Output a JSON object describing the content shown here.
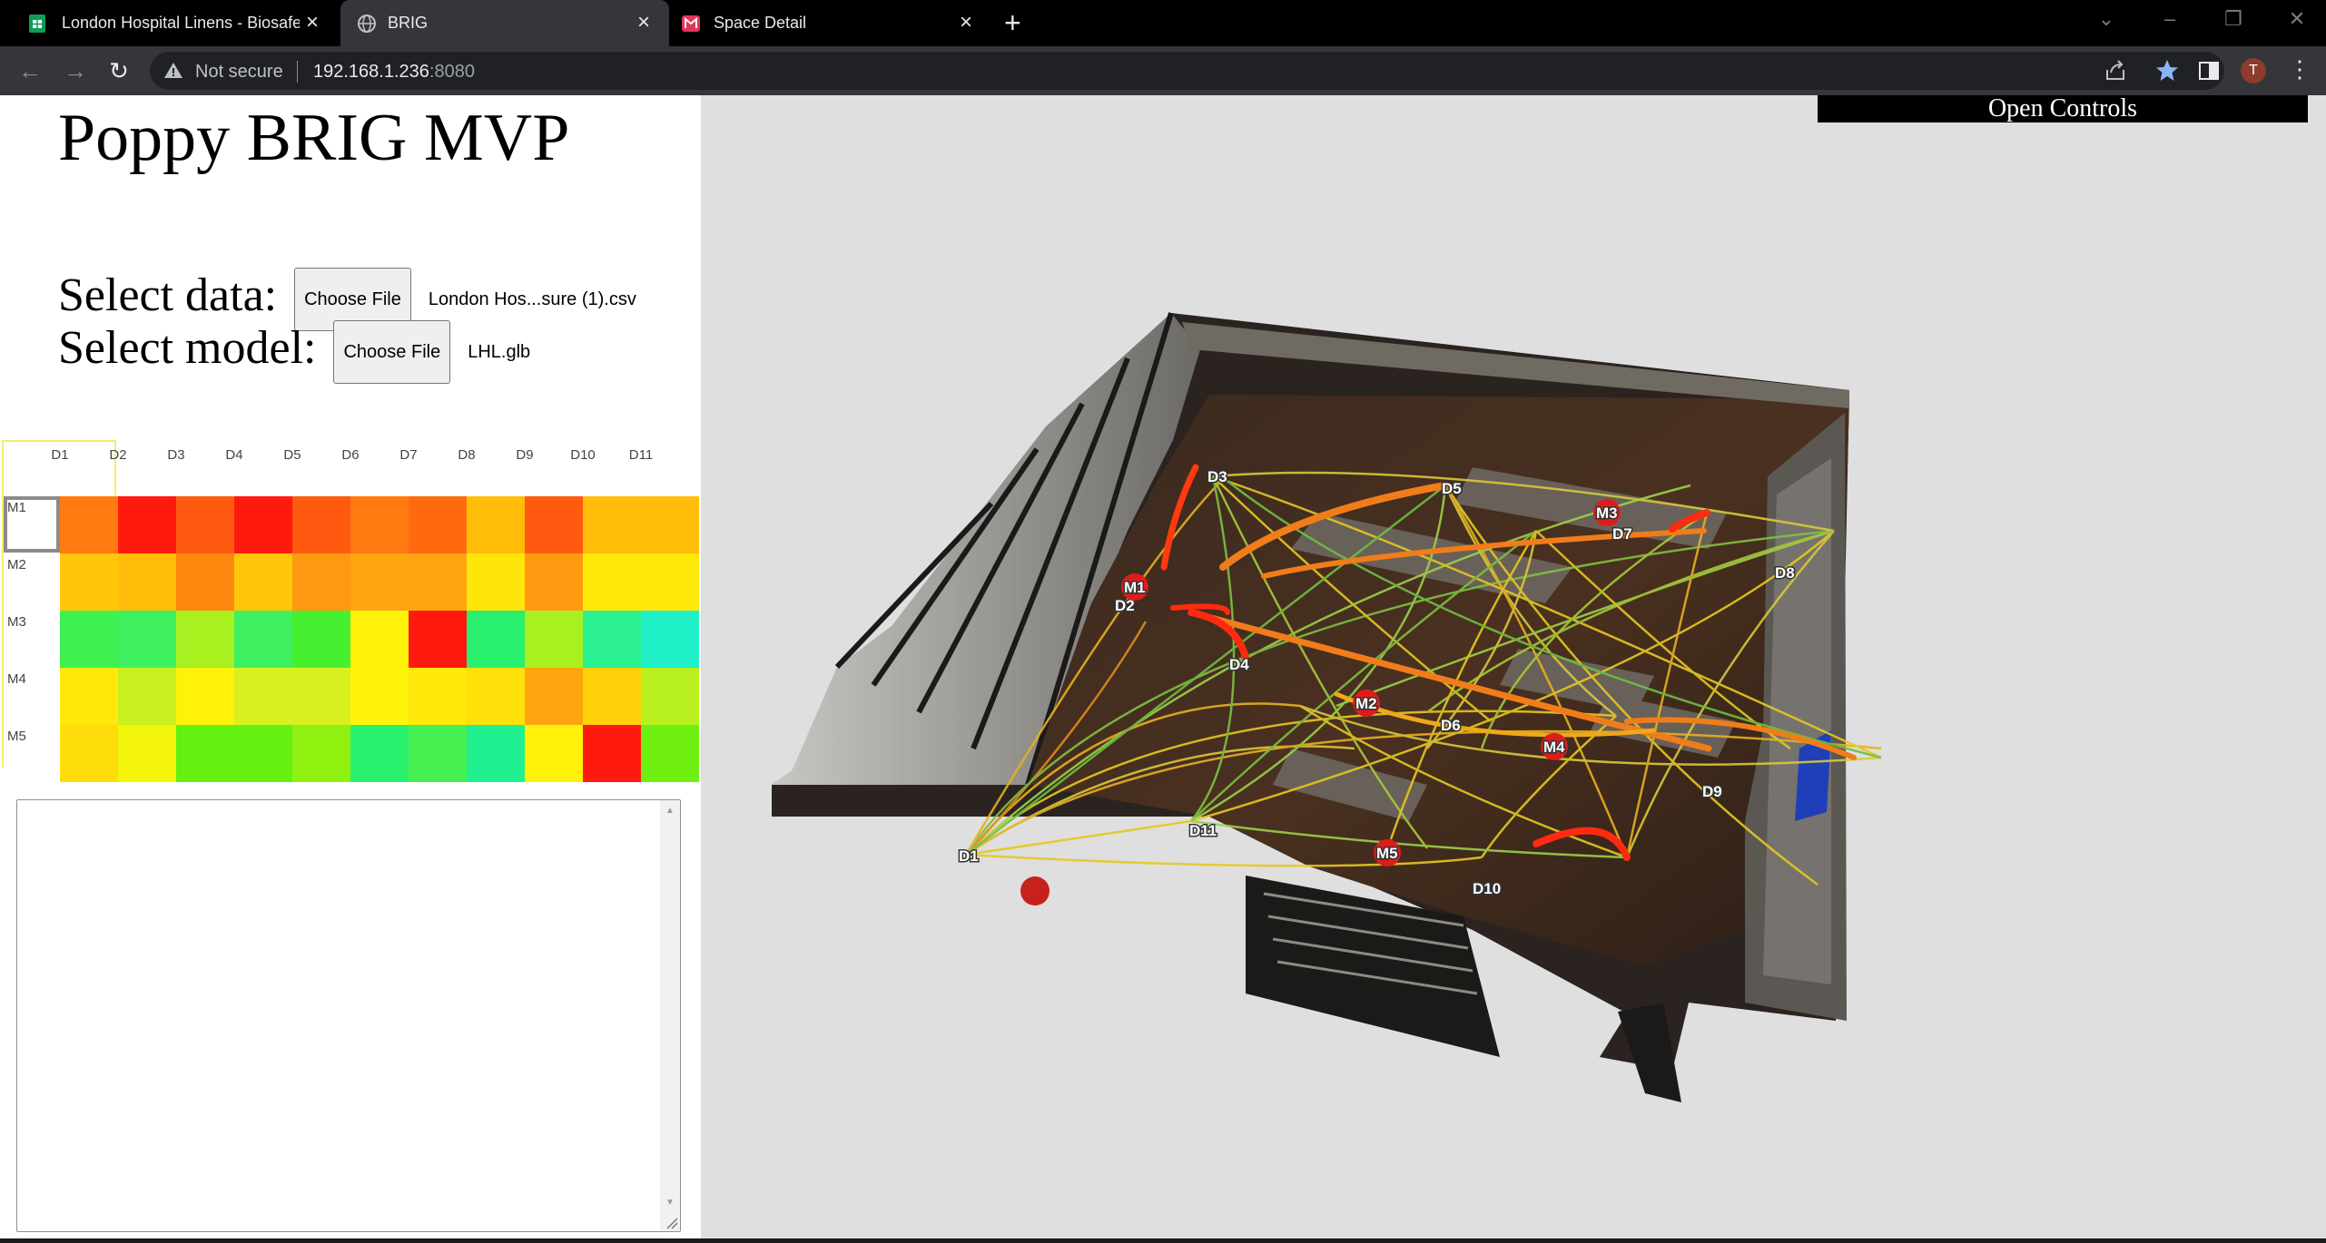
{
  "browser": {
    "tabs": [
      {
        "label": "London Hospital Linens - Biosafe",
        "icon": "sheets-icon",
        "active": false
      },
      {
        "label": "BRIG",
        "icon": "globe-icon",
        "active": true
      },
      {
        "label": "Space Detail",
        "icon": "matterport-icon",
        "active": false
      }
    ],
    "new_tab": "+",
    "address": {
      "security": "Not secure",
      "host": "192.168.1.236",
      "port": ":8080"
    },
    "profile_initial": "T"
  },
  "page": {
    "title": "Poppy BRIG MVP",
    "select_data": {
      "label": "Select data:",
      "button": "Choose File",
      "file": "London Hos...sure (1).csv"
    },
    "select_model": {
      "label": "Select model:",
      "button": "Choose File",
      "file": "LHL.glb"
    },
    "heatmap": {
      "columns": [
        "D1",
        "D2",
        "D3",
        "D4",
        "D5",
        "D6",
        "D7",
        "D8",
        "D9",
        "D10",
        "D11"
      ],
      "rows": [
        {
          "label": "M1",
          "colors": [
            "#ff7a10",
            "#ff1a10",
            "#ff5a10",
            "#ff1a10",
            "#ff5a10",
            "#ff7a10",
            "#ff6a10",
            "#ffbd0a",
            "#ff5a10",
            "#ffbd0a",
            "#ffbd0a"
          ]
        },
        {
          "label": "M2",
          "colors": [
            "#ffc60a",
            "#ffbd0a",
            "#ff8810",
            "#ffc60a",
            "#ff9a10",
            "#ffa510",
            "#ffa510",
            "#ffe50a",
            "#ff9a10",
            "#ffe80a",
            "#ffe80a"
          ]
        },
        {
          "label": "M3",
          "colors": [
            "#3ef050",
            "#3ef060",
            "#a8f020",
            "#3ef060",
            "#46f030",
            "#fff20a",
            "#ff1a10",
            "#2af070",
            "#a8f020",
            "#2af090",
            "#20f0c8"
          ]
        },
        {
          "label": "M4",
          "colors": [
            "#ffe80a",
            "#c8f020",
            "#fff20a",
            "#d8f020",
            "#d8f020",
            "#fff20a",
            "#ffe80a",
            "#ffe00a",
            "#ffa510",
            "#ffd00a",
            "#b8f020"
          ]
        },
        {
          "label": "M5",
          "colors": [
            "#ffdd0a",
            "#f2f50a",
            "#64f010",
            "#64f010",
            "#90f010",
            "#2af070",
            "#46f050",
            "#20f090",
            "#fff20a",
            "#ff1a10",
            "#70f010"
          ]
        }
      ]
    },
    "log_text": "",
    "open_controls": "Open Controls"
  },
  "scene": {
    "nodes": [
      {
        "id": "D1",
        "kind": "sensor"
      },
      {
        "id": "D2",
        "kind": "sensor"
      },
      {
        "id": "D3",
        "kind": "sensor"
      },
      {
        "id": "D4",
        "kind": "sensor"
      },
      {
        "id": "D5",
        "kind": "sensor"
      },
      {
        "id": "D6",
        "kind": "sensor"
      },
      {
        "id": "D7",
        "kind": "sensor"
      },
      {
        "id": "D8",
        "kind": "sensor"
      },
      {
        "id": "D9",
        "kind": "sensor"
      },
      {
        "id": "D10",
        "kind": "sensor"
      },
      {
        "id": "D11",
        "kind": "sensor"
      },
      {
        "id": "M1",
        "kind": "marker"
      },
      {
        "id": "M2",
        "kind": "marker"
      },
      {
        "id": "M3",
        "kind": "marker"
      },
      {
        "id": "M4",
        "kind": "marker"
      },
      {
        "id": "M5",
        "kind": "marker"
      }
    ]
  }
}
